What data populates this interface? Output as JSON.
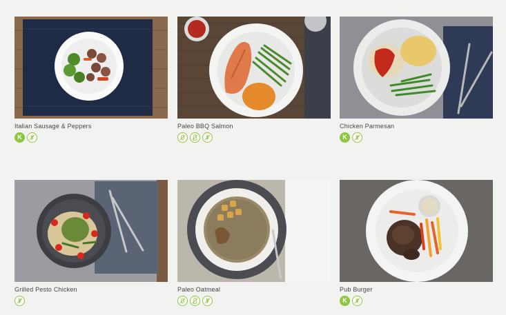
{
  "meals": [
    {
      "name": "Italian Sausage & Peppers",
      "badges": [
        "k-icon",
        "no-gluten-icon"
      ]
    },
    {
      "name": "Paleo BBQ Salmon",
      "badges": [
        "no-grain-icon",
        "no-dairy-icon",
        "no-gluten-icon"
      ]
    },
    {
      "name": "Chicken Parmesan",
      "badges": [
        "k-icon",
        "no-gluten-icon"
      ]
    },
    {
      "name": "Grilled Pesto Chicken",
      "badges": [
        "no-gluten-icon"
      ]
    },
    {
      "name": "Paleo Oatmeal",
      "badges": [
        "no-grain-icon",
        "no-dairy-icon",
        "no-gluten-icon"
      ]
    },
    {
      "name": "Pub Burger",
      "badges": [
        "k-icon",
        "no-gluten-icon"
      ]
    }
  ],
  "badge_labels": {
    "k": "K"
  },
  "colors": {
    "accent": "#8dc63f",
    "background": "#f2f2f0",
    "text": "#444444"
  }
}
